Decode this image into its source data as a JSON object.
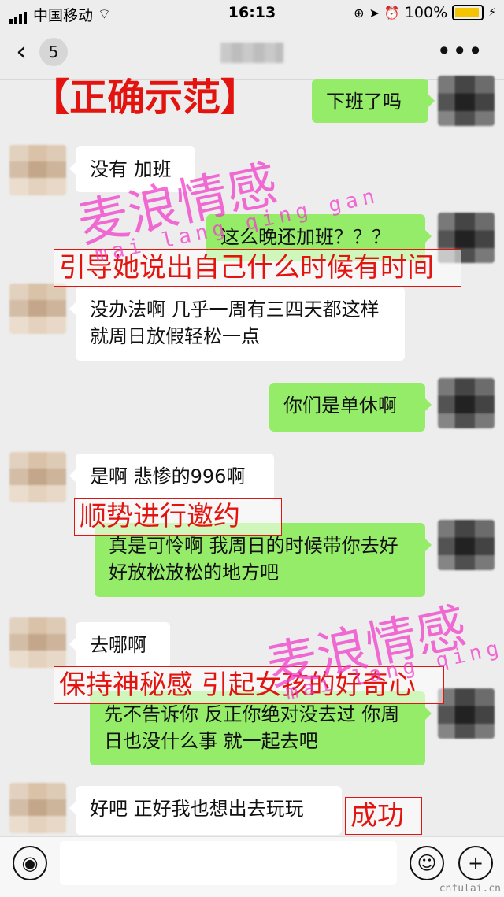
{
  "status_bar": {
    "carrier": "中国移动",
    "time": "16:13",
    "battery": "100%"
  },
  "nav": {
    "back_icon": "chevron-left-icon",
    "unread_count": "5",
    "more_icon": "more-dots-icon"
  },
  "annotations": {
    "title": "【正确示范】",
    "lead_time": "引导她说出自己什么时候有时间",
    "invite": "顺势进行邀约",
    "mystery": "保持神秘感 引起女孩的好奇心",
    "success": "成功"
  },
  "watermark": {
    "brand": "麦浪情感",
    "pinyin": "mai lang qing gan"
  },
  "messages": [
    {
      "side": "right",
      "text": "下班了吗"
    },
    {
      "side": "left",
      "text": "没有 加班"
    },
    {
      "side": "right",
      "text": "这么晚还加班？？？"
    },
    {
      "side": "left",
      "text": "没办法啊 几乎一周有三四天都这样 就周日放假轻松一点"
    },
    {
      "side": "right",
      "text": "你们是单休啊"
    },
    {
      "side": "left",
      "text": "是啊 悲惨的996啊"
    },
    {
      "side": "right",
      "text": "真是可怜啊 我周日的时候带你去好好放松放松的地方吧"
    },
    {
      "side": "left",
      "text": "去哪啊"
    },
    {
      "side": "right",
      "text": "先不告诉你 反正你绝对没去过 你周日也没什么事 就一起去吧"
    },
    {
      "side": "left",
      "text": "好吧 正好我也想出去玩玩"
    }
  ],
  "input_bar": {
    "voice_icon": "voice-icon",
    "emoji_icon": "emoji-icon",
    "plus_icon": "plus-icon"
  },
  "site_mark": "cnfulai.cn",
  "colors": {
    "bubble_self": "#95ec69",
    "bubble_other": "#ffffff",
    "annotation": "#e3130f",
    "watermark": "#f03cc8"
  }
}
